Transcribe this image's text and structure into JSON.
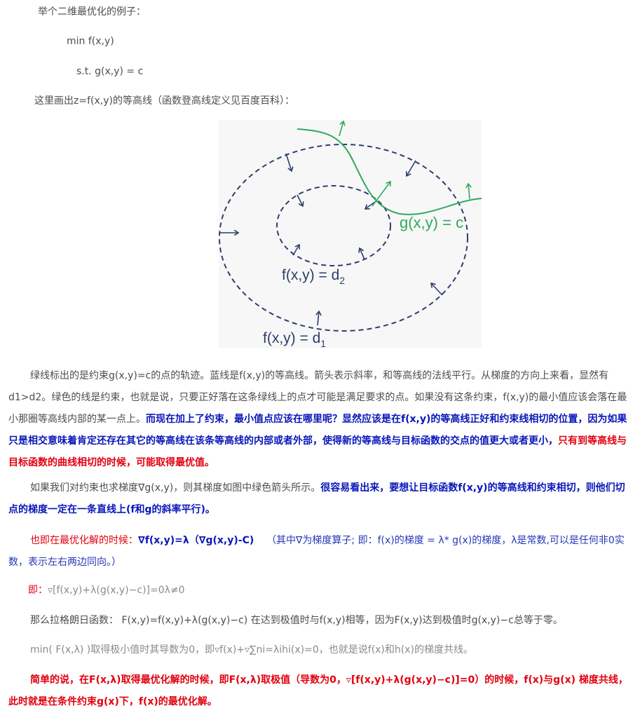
{
  "intro": {
    "example_heading": "举个二维最优化的例子：",
    "objective": "min f(x,y)",
    "constraint": "s.t. g(x,y) = c",
    "contour_intro": "这里画出z=f(x,y)的等高线（函数登高线定义见百度百科）："
  },
  "figure": {
    "label_g": "g(x,y) = c",
    "label_d2_main": "f(x,y) = d",
    "label_d2_sub": "2",
    "label_d1_main": "f(x,y) = d",
    "label_d1_sub": "1",
    "colors": {
      "background": "#f7f7f7",
      "contour": "#2f3e6b",
      "constraint": "#2eaa5c"
    }
  },
  "paragraph1": {
    "plain": "绿线标出的是约束g(x,y)=c的点的轨迹。蓝线是f(x,y)的等高线。箭头表示斜率，和等高线的法线平行。从梯度的方向上来看，显然有d1>d2。绿色的线是约束，也就是说，只要正好落在这条绿线上的点才可能是满足要求的点。如果没有这条约束，f(x,y)的最小值应该会落在最小那圈等高线内部的某一点上。",
    "blue_bold": "而现在加上了约束，最小值点应该在哪里呢？显然应该是在f(x,y)的等高线正好和约束线相切的位置，因为如果只是相交意味着肯定还存在其它的等高线在该条等高线的内部或者外部，使得新的等高线与目标函数的交点的值更大或者更小，",
    "red_bold": "只有到等高线与目标函数的曲线相切的时候，可能取得最优值。"
  },
  "paragraph2": {
    "plain": "如果我们对约束也求梯度∇g(x,y)，则其梯度如图中绿色箭头所示。",
    "blue_bold": "很容易看出来，要想让目标函数f(x,y)的等高线和约束相切，则他们切点的梯度一定在一条直线上(f和g的斜率平行)。"
  },
  "paragraph3": {
    "red_plain": "也即在最优化解的时候：",
    "blue_bold": "∇f(x,y)=λ（∇g(x,y)-C)",
    "blue_note": "（其中∇为梯度算子; 即：f(x)的梯度 = λ* g(x)的梯度，λ是常数,可以是任何非0实数，表示左右两边同向。）"
  },
  "formula_line": {
    "prefix": "即：",
    "body": "▿[f(x,y)+λ(g(x,y)−c)]=0λ≠0"
  },
  "lagrange_line": {
    "text": "那么拉格朗日函数： F(x,y)=f(x,y)+λ(g(x,y)−c) 在达到极值时与f(x,y)相等，因为F(x,y)达到极值时g(x,y)−c总等于零。"
  },
  "min_line": {
    "text": "min( F(x,λ) )取得极小值时其导数为0，即▿f(x)+▿∑ni=λihi(x)=0，也就是说f(x)和h(x)的梯度共线。"
  },
  "summary": {
    "text": "简单的说，在F(x,λ)取得最优化解的时候，即F(x,λ)取极值（导数为0，▿[f(x,y)+λ(g(x,y)−c)]=0）的时候，f(x)与g(x) 梯度共线，此时就是在条件约束g(x)下，f(x)的最优化解。"
  }
}
